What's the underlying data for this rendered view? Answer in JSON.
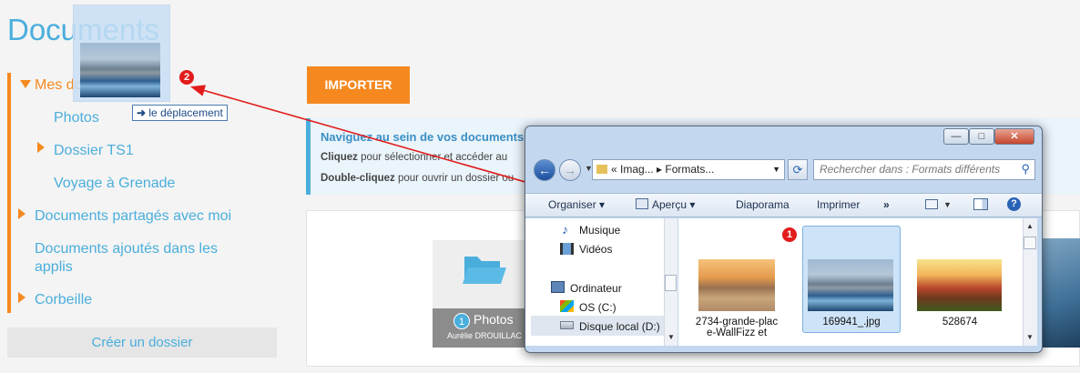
{
  "page": {
    "title": "Documents"
  },
  "sidebar": {
    "items": [
      {
        "label": "Mes documents"
      },
      {
        "label": "Photos"
      },
      {
        "label": "Dossier TS1"
      },
      {
        "label": "Voyage à Grenade"
      },
      {
        "label": "Documents partagés avec moi"
      },
      {
        "label": "Documents ajoutés dans les"
      },
      {
        "label": "applis"
      },
      {
        "label": "Corbeille"
      }
    ],
    "create_label": "Créer un dossier"
  },
  "main": {
    "import_label": "IMPORTER",
    "info": {
      "title": "Naviguez au sein de vos documents",
      "line1_bold": "Cliquez",
      "line1_rest": " pour sélectionner et accéder au",
      "line2_bold": "Double-cliquez",
      "line2_rest": " pour ouvrir un dossier ou"
    },
    "folder": {
      "count": "1",
      "name": "Photos",
      "owner": "Aurélie DROUILLAC"
    }
  },
  "drag": {
    "tooltip": "le déplacement",
    "badge": "2"
  },
  "explorer": {
    "title_buttons": [
      "—",
      "□",
      "✕"
    ],
    "address": "« Imag...  ▸ Formats...",
    "search_placeholder": "Rechercher dans : Formats différents",
    "toolbar": {
      "organize": "Organiser ▾",
      "preview": "Aperçu ▾",
      "slideshow": "Diaporama",
      "print": "Imprimer",
      "more": "»"
    },
    "nav_items": [
      "Musique",
      "Vidéos",
      "Ordinateur",
      "OS (C:)",
      "Disque local (D:)"
    ],
    "badge": "1",
    "files": [
      {
        "name_line1": "2734-grande-plac",
        "name_line2": "e-WallFizz et"
      },
      {
        "name_line1": "169941_.jpg",
        "name_line2": ""
      },
      {
        "name_line1": "528674",
        "name_line2": ""
      }
    ]
  },
  "colors": {
    "accent": "#f5891f",
    "link": "#4aaedc",
    "badge": "#e21c1c"
  }
}
